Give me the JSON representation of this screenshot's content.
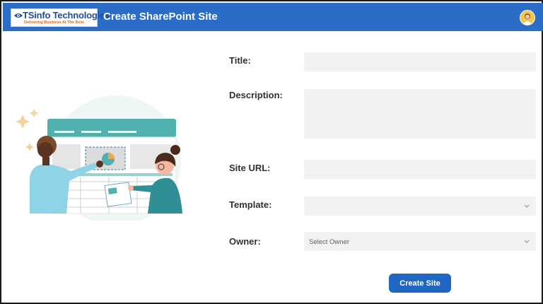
{
  "header": {
    "logo_text": "TSinfo Technologies",
    "logo_tagline": "Delivering Business At The Best",
    "title": "Create SharePoint Site",
    "avatar_icon": "user-avatar"
  },
  "form": {
    "title_label": "Title:",
    "title_value": "",
    "description_label": "Description:",
    "description_value": "",
    "site_url_label": "Site URL:",
    "site_url_value": "",
    "template_label": "Template:",
    "template_value": "",
    "owner_label": "Owner:",
    "owner_placeholder": "Select Owner",
    "submit_label": "Create Site"
  },
  "colors": {
    "header_bg": "#2a6cc6",
    "button_bg": "#1f67c2",
    "field_bg": "#f3f2f1",
    "illustration_accent": "#4fb0ad"
  }
}
